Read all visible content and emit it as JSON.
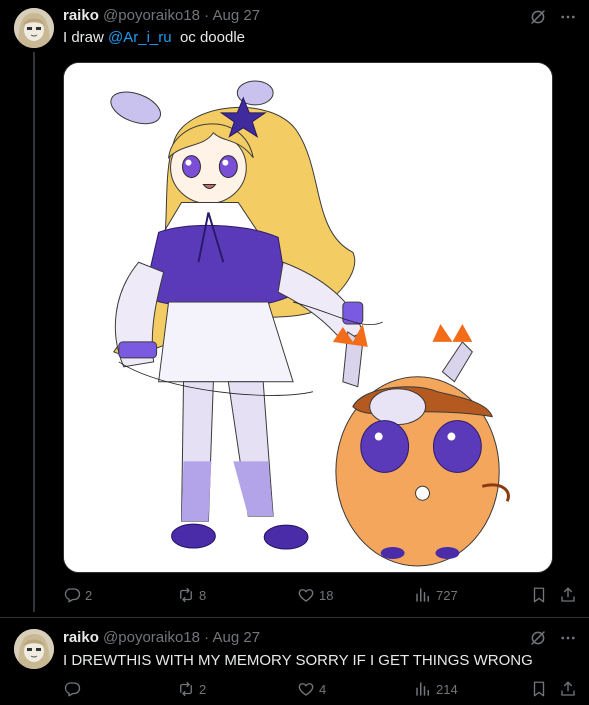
{
  "colors": {
    "background": "#000000",
    "text": "#e7e9ea",
    "muted": "#71767b",
    "link": "#1d9bf0",
    "divider": "#2f3336"
  },
  "tweets": [
    {
      "display_name": "raiko",
      "handle": "@poyoraiko18",
      "separator": "·",
      "date": "Aug 27",
      "text_before": "I draw ",
      "mention": "@Ar_i_ru",
      "text_after": "  oc doodle",
      "media": "illustration of a chibi blonde girl with purple star clip and an orange round creature",
      "stats": {
        "replies": "2",
        "reposts": "8",
        "likes": "18",
        "views": "727"
      },
      "icons": [
        "grok-icon",
        "more-icon",
        "reply-icon",
        "repost-icon",
        "like-icon",
        "views-icon",
        "bookmark-icon",
        "share-icon"
      ]
    },
    {
      "display_name": "raiko",
      "handle": "@poyoraiko18",
      "separator": "·",
      "date": "Aug 27",
      "text": "I DREWTHIS WITH MY MEMORY SORRY IF I GET THINGS WRONG",
      "stats": {
        "replies": "",
        "reposts": "2",
        "likes": "4",
        "views": "214"
      }
    }
  ]
}
